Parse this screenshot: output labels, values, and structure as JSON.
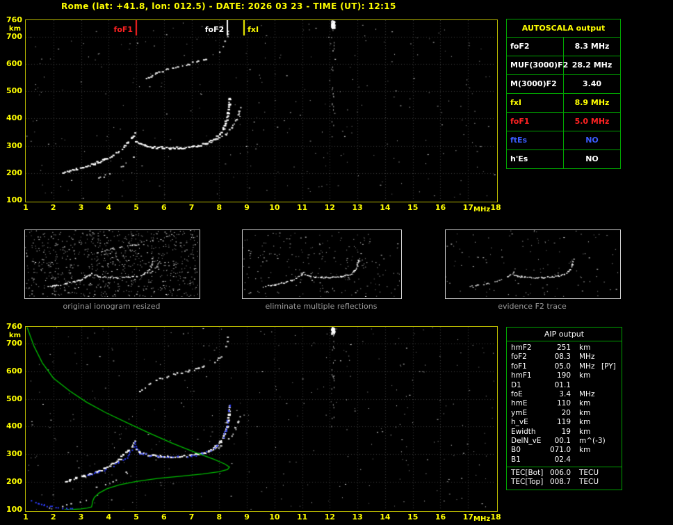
{
  "title": "Rome (lat: +41.8, lon: 012.5) - DATE: 2026 03 23 - TIME (UT): 12:15",
  "colors": {
    "background": "#000000",
    "axis_labels": "#ffff00",
    "plot_border": "#b9b900",
    "grid": "#3c3c3c",
    "trace_white": "#ffffff",
    "profile_green": "#00bb00",
    "restored_blue": "#2e3eff",
    "table_border": "#00a400",
    "caption_gray": "#9a9a9a",
    "fof1_red": "#ff2222",
    "fxi_yellow": "#ffff00",
    "ftes_blue": "#3a5cff"
  },
  "axes": {
    "x_unit": "MHz",
    "y_unit": "km",
    "x_ticks": [
      1,
      2,
      3,
      4,
      5,
      6,
      7,
      8,
      9,
      10,
      11,
      12,
      13,
      14,
      15,
      16,
      17,
      18
    ],
    "y_ticks": [
      760,
      700,
      600,
      500,
      400,
      300,
      200,
      100
    ],
    "x_range": [
      1,
      18
    ],
    "y_range": [
      100,
      760
    ]
  },
  "main_plot": {
    "markers": [
      {
        "label": "foF1",
        "freq": 5.0,
        "color": "#ff2222",
        "label_side": "left"
      },
      {
        "label": "foF2",
        "freq": 8.3,
        "color": "#ffffff",
        "label_side": "left"
      },
      {
        "label": "fxI",
        "freq": 8.9,
        "color": "#ffff00",
        "label_side": "right"
      }
    ]
  },
  "autoscala_table": {
    "title": "AUTOSCALA output",
    "rows": [
      {
        "param": "foF2",
        "value": "8.3 MHz",
        "color": "#ffffff"
      },
      {
        "param": "MUF(3000)F2",
        "value": "28.2 MHz",
        "color": "#ffffff"
      },
      {
        "param": "M(3000)F2",
        "value": "3.40",
        "color": "#ffffff"
      },
      {
        "param": "fxI",
        "value": "8.9 MHz",
        "color": "#ffff00"
      },
      {
        "param": "foF1",
        "value": "5.0 MHz",
        "color": "#ff2222"
      },
      {
        "param": "ftEs",
        "value": "NO",
        "color": "#3a5cff"
      },
      {
        "param": "h'Es",
        "value": "NO",
        "color": "#ffffff"
      }
    ]
  },
  "thumbnails": [
    {
      "caption": "original ionogram resized"
    },
    {
      "caption": "eliminate multiple reflections"
    },
    {
      "caption": "evidence F2 trace"
    }
  ],
  "aip_table": {
    "title": "AIP output",
    "rows": [
      {
        "param": "hmF2",
        "value": "251",
        "unit": "km",
        "note": ""
      },
      {
        "param": "foF2",
        "value": "08.3",
        "unit": "MHz",
        "note": ""
      },
      {
        "param": "foF1",
        "value": "05.0",
        "unit": "MHz",
        "note": "[PY]"
      },
      {
        "param": "hmF1",
        "value": "190",
        "unit": "km",
        "note": ""
      },
      {
        "param": "D1",
        "value": "01.1",
        "unit": "",
        "note": ""
      },
      {
        "param": "foE",
        "value": "3.4",
        "unit": "MHz",
        "note": ""
      },
      {
        "param": "hmE",
        "value": "110",
        "unit": "km",
        "note": ""
      },
      {
        "param": "ymE",
        "value": "20",
        "unit": "km",
        "note": ""
      },
      {
        "param": "h_vE",
        "value": "119",
        "unit": "km",
        "note": ""
      },
      {
        "param": "Ewidth",
        "value": "19",
        "unit": "km",
        "note": ""
      },
      {
        "param": "DelN_vE",
        "value": "00.1",
        "unit": "m^(-3)",
        "note": ""
      },
      {
        "param": "B0",
        "value": "071.0",
        "unit": "km",
        "note": ""
      },
      {
        "param": "B1",
        "value": "02.4",
        "unit": "",
        "note": ""
      }
    ],
    "tec_rows": [
      {
        "param": "TEC[Bot]",
        "value": "006.0",
        "unit": "TECU"
      },
      {
        "param": "TEC[Top]",
        "value": "008.7",
        "unit": "TECU"
      }
    ]
  },
  "chart_data": {
    "type": "scatter",
    "title": "Ionogram echo traces, virtual height (km) vs sounding frequency (MHz)",
    "xlabel": "MHz",
    "ylabel": "km",
    "xlim": [
      1,
      18
    ],
    "ylim": [
      100,
      760
    ],
    "grid": true,
    "critical_markers": [
      {
        "label": "foF1",
        "freq": 5.0
      },
      {
        "label": "foF2",
        "freq": 8.3
      },
      {
        "label": "fxI",
        "freq": 8.9
      }
    ],
    "traces": {
      "F1_layer": [
        [
          2.35,
          200
        ],
        [
          2.6,
          206
        ],
        [
          2.85,
          213
        ],
        [
          3.1,
          220
        ],
        [
          3.35,
          228
        ],
        [
          3.6,
          238
        ],
        [
          3.85,
          249
        ],
        [
          4.1,
          262
        ],
        [
          4.35,
          278
        ],
        [
          4.55,
          295
        ],
        [
          4.72,
          312
        ],
        [
          4.85,
          330
        ],
        [
          4.95,
          345
        ]
      ],
      "F2_layer": [
        [
          5.02,
          316
        ],
        [
          5.15,
          306
        ],
        [
          5.35,
          299
        ],
        [
          5.6,
          295
        ],
        [
          5.9,
          292
        ],
        [
          6.25,
          291
        ],
        [
          6.6,
          291
        ],
        [
          6.95,
          294
        ],
        [
          7.25,
          299
        ],
        [
          7.5,
          306
        ],
        [
          7.72,
          315
        ],
        [
          7.9,
          327
        ],
        [
          8.05,
          343
        ],
        [
          8.17,
          363
        ],
        [
          8.26,
          389
        ],
        [
          8.32,
          417
        ],
        [
          8.36,
          447
        ],
        [
          8.38,
          475
        ]
      ],
      "F2_x_mode": [
        [
          7.35,
          304
        ],
        [
          7.7,
          313
        ],
        [
          8.0,
          326
        ],
        [
          8.25,
          343
        ],
        [
          8.45,
          366
        ],
        [
          8.6,
          392
        ],
        [
          8.7,
          418
        ],
        [
          8.78,
          446
        ]
      ],
      "second_hop": [
        [
          5.15,
          530
        ],
        [
          5.45,
          550
        ],
        [
          5.75,
          566
        ],
        [
          6.1,
          580
        ],
        [
          6.5,
          591
        ],
        [
          6.9,
          600
        ],
        [
          7.25,
          609
        ],
        [
          7.55,
          618
        ]
      ],
      "second_hop_asymptote": [
        [
          7.85,
          630
        ],
        [
          8.05,
          648
        ],
        [
          8.2,
          672
        ],
        [
          8.3,
          700
        ],
        [
          8.34,
          728
        ]
      ],
      "F1_lower_scatter": [
        [
          3.5,
          176
        ],
        [
          3.9,
          190
        ],
        [
          4.3,
          210
        ],
        [
          4.65,
          234
        ],
        [
          4.9,
          260
        ]
      ],
      "E_scatter": [
        [
          1.6,
          106
        ],
        [
          2.0,
          110
        ],
        [
          2.4,
          116
        ],
        [
          2.8,
          123
        ],
        [
          3.2,
          131
        ]
      ]
    },
    "profile_green": [
      [
        1.05,
        758
      ],
      [
        1.3,
        690
      ],
      [
        1.6,
        630
      ],
      [
        2.0,
        575
      ],
      [
        2.6,
        528
      ],
      [
        3.2,
        488
      ],
      [
        3.9,
        450
      ],
      [
        4.7,
        412
      ],
      [
        5.5,
        375
      ],
      [
        6.3,
        340
      ],
      [
        7.1,
        308
      ],
      [
        7.8,
        282
      ],
      [
        8.2,
        265
      ],
      [
        8.37,
        254
      ],
      [
        8.3,
        245
      ],
      [
        8.0,
        237
      ],
      [
        7.4,
        229
      ],
      [
        6.6,
        221
      ],
      [
        5.8,
        213
      ],
      [
        5.0,
        202
      ],
      [
        4.4,
        190
      ],
      [
        3.95,
        176
      ],
      [
        3.65,
        160
      ],
      [
        3.48,
        144
      ],
      [
        3.42,
        130
      ],
      [
        3.4,
        118
      ],
      [
        3.38,
        110
      ],
      [
        3.22,
        106
      ],
      [
        3.0,
        103
      ],
      [
        2.7,
        101
      ],
      [
        2.4,
        100
      ]
    ],
    "restored_trace_blue_F": [
      [
        3.2,
        222
      ],
      [
        3.7,
        236
      ],
      [
        4.2,
        258
      ],
      [
        4.6,
        284
      ],
      [
        4.85,
        314
      ],
      [
        4.97,
        342
      ],
      [
        5.1,
        304
      ],
      [
        5.5,
        295
      ],
      [
        6.0,
        290
      ],
      [
        6.5,
        290
      ],
      [
        7.0,
        294
      ],
      [
        7.4,
        302
      ],
      [
        7.7,
        314
      ],
      [
        7.95,
        332
      ],
      [
        8.12,
        356
      ],
      [
        8.24,
        385
      ],
      [
        8.31,
        415
      ],
      [
        8.36,
        452
      ],
      [
        8.38,
        478
      ]
    ],
    "restored_trace_blue_E": [
      [
        1.05,
        138
      ],
      [
        1.35,
        126
      ],
      [
        1.7,
        116
      ],
      [
        2.1,
        108
      ],
      [
        2.5,
        102
      ],
      [
        2.95,
        100
      ]
    ],
    "interference_freq_mhz": 12.1
  }
}
